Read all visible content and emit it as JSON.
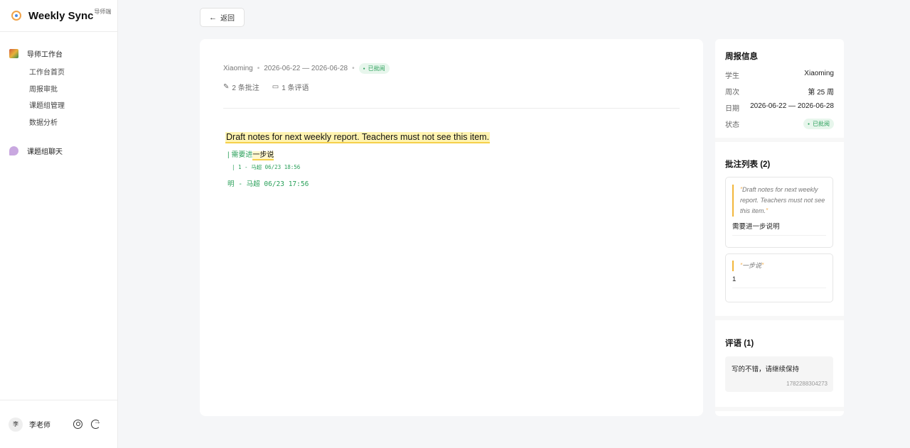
{
  "app": {
    "title": "Weekly Sync",
    "tag": "导师端"
  },
  "sidebar": {
    "workbench_label": "导师工作台",
    "items": [
      "工作台首页",
      "周报审批",
      "课题组管理",
      "数据分析"
    ],
    "chat_label": "课题组聊天"
  },
  "user": {
    "avatar": "李",
    "name": "李老师"
  },
  "back_label": "返回",
  "report": {
    "student": "Xiaoming",
    "date_range": "2026-06-22 — 2026-06-28",
    "status": "已批阅",
    "annotations_count": "2 条批注",
    "comments_count": "1 条评语",
    "content": "Draft notes for next weekly report. Teachers must not see this item.",
    "inline_comment_prefix": "| 需要进",
    "inline_comment_selected": "一步说",
    "inline_reply": "| 1 - 马超 06/23 18:56",
    "inline_tail": "明 - 马超 06/23 17:56"
  },
  "info": {
    "title": "周报信息",
    "student_label": "学生",
    "student_value": "Xiaoming",
    "week_label": "周次",
    "week_value": "第 25 周",
    "date_label": "日期",
    "date_value": "2026-06-22 — 2026-06-28",
    "status_label": "状态",
    "status_value": "已批阅"
  },
  "annotations": {
    "title": "批注列表 (2)",
    "items": [
      {
        "quote": "Draft notes for next weekly report. Teachers must not see this item.",
        "text": "需要进一步说明"
      },
      {
        "quote": "一步说",
        "text": "1"
      }
    ]
  },
  "remarks": {
    "title": "评语 (1)",
    "text": "写的不错，请继续保持",
    "timestamp": "1782288304273"
  },
  "colors": {
    "accent_green": "#2aa05a",
    "highlight": "#f5d04a",
    "quote_bar": "#f2b63a"
  }
}
